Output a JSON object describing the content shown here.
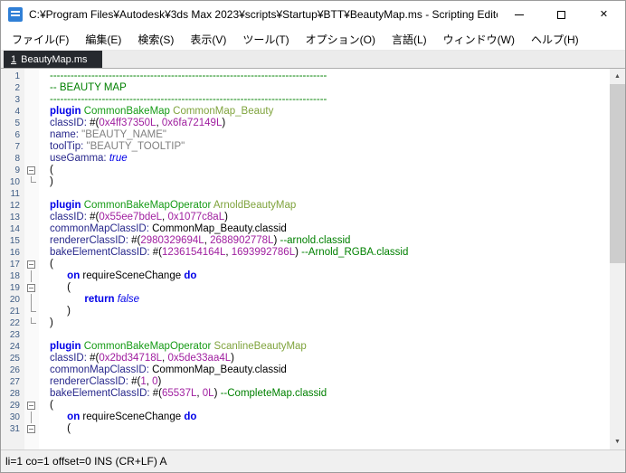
{
  "window": {
    "title": "C:¥Program Files¥Autodesk¥3ds Max 2023¥scripts¥Startup¥BTT¥BeautyMap.ms - Scripting Editor"
  },
  "icons": {
    "close": "✕",
    "scroll_up": "▲",
    "scroll_down": "▼"
  },
  "menu": {
    "items": [
      "ファイル(F)",
      "編集(E)",
      "検索(S)",
      "表示(V)",
      "ツール(T)",
      "オプション(O)",
      "言語(L)",
      "ウィンドウ(W)",
      "ヘルプ(H)"
    ]
  },
  "tab": {
    "number": "1",
    "label": "BeautyMap.ms"
  },
  "colors": {
    "comment": "#008000",
    "keyword": "#0000e8",
    "typename": "#169b16",
    "instance": "#7fa33c",
    "property": "#28288c",
    "number": "#a020a0",
    "string": "#808080",
    "plain": "#000000",
    "line_number": "#3e5c84",
    "active_tab": "#26292e"
  },
  "editor": {
    "lines": [
      {
        "n": 1,
        "fold": "",
        "segs": [
          [
            "cm",
            "--------------------------------------------------------------------------------"
          ]
        ]
      },
      {
        "n": 2,
        "fold": "",
        "segs": [
          [
            "cm",
            "-- BEAUTY MAP"
          ]
        ]
      },
      {
        "n": 3,
        "fold": "",
        "segs": [
          [
            "cm",
            "--------------------------------------------------------------------------------"
          ]
        ]
      },
      {
        "n": 4,
        "fold": "",
        "segs": [
          [
            "kw",
            "plugin"
          ],
          [
            "pl",
            " "
          ],
          [
            "ty",
            "CommonBakeMap"
          ],
          [
            "pl",
            " "
          ],
          [
            "nm",
            "CommonMap_Beauty"
          ]
        ]
      },
      {
        "n": 5,
        "fold": "",
        "segs": [
          [
            "pr",
            "classID:"
          ],
          [
            "pl",
            " #("
          ],
          [
            "num",
            "0x4ff37350L"
          ],
          [
            "pl",
            ", "
          ],
          [
            "num",
            "0x6fa72149L"
          ],
          [
            "pl",
            ")"
          ]
        ]
      },
      {
        "n": 6,
        "fold": "",
        "segs": [
          [
            "pr",
            "name:"
          ],
          [
            "pl",
            " "
          ],
          [
            "str",
            "\"BEAUTY_NAME\""
          ]
        ]
      },
      {
        "n": 7,
        "fold": "",
        "segs": [
          [
            "pr",
            "toolTip:"
          ],
          [
            "pl",
            " "
          ],
          [
            "str",
            "\"BEAUTY_TOOLTIP\""
          ]
        ]
      },
      {
        "n": 8,
        "fold": "",
        "segs": [
          [
            "pr",
            "useGamma:"
          ],
          [
            "pl",
            " "
          ],
          [
            "it",
            "true"
          ]
        ]
      },
      {
        "n": 9,
        "fold": "box",
        "segs": [
          [
            "pl",
            "("
          ]
        ]
      },
      {
        "n": 10,
        "fold": "end",
        "segs": [
          [
            "pl",
            ")"
          ]
        ]
      },
      {
        "n": 11,
        "fold": "",
        "segs": []
      },
      {
        "n": 12,
        "fold": "",
        "segs": [
          [
            "kw",
            "plugin"
          ],
          [
            "pl",
            " "
          ],
          [
            "ty",
            "CommonBakeMapOperator"
          ],
          [
            "pl",
            " "
          ],
          [
            "nm",
            "ArnoldBeautyMap"
          ]
        ]
      },
      {
        "n": 13,
        "fold": "",
        "segs": [
          [
            "pr",
            "classID:"
          ],
          [
            "pl",
            " #("
          ],
          [
            "num",
            "0x55ee7bdeL"
          ],
          [
            "pl",
            ", "
          ],
          [
            "num",
            "0x1077c8aL"
          ],
          [
            "pl",
            ")"
          ]
        ]
      },
      {
        "n": 14,
        "fold": "",
        "segs": [
          [
            "pr",
            "commonMapClassID:"
          ],
          [
            "pl",
            " CommonMap_Beauty.classid"
          ]
        ]
      },
      {
        "n": 15,
        "fold": "",
        "segs": [
          [
            "pr",
            "rendererClassID:"
          ],
          [
            "pl",
            " #("
          ],
          [
            "num",
            "2980329694L"
          ],
          [
            "pl",
            ", "
          ],
          [
            "num",
            "2688902778L"
          ],
          [
            "pl",
            ") "
          ],
          [
            "cm",
            "--arnold.classid"
          ]
        ]
      },
      {
        "n": 16,
        "fold": "",
        "segs": [
          [
            "pr",
            "bakeElementClassID:"
          ],
          [
            "pl",
            " #("
          ],
          [
            "num",
            "1236154164L"
          ],
          [
            "pl",
            ", "
          ],
          [
            "num",
            "1693992786L"
          ],
          [
            "pl",
            ") "
          ],
          [
            "cm",
            "--Arnold_RGBA.classid"
          ]
        ]
      },
      {
        "n": 17,
        "fold": "box",
        "segs": [
          [
            "pl",
            "("
          ]
        ]
      },
      {
        "n": 18,
        "fold": "vline",
        "segs": [
          [
            "pl",
            "      "
          ],
          [
            "kw",
            "on"
          ],
          [
            "pl",
            " requireSceneChange "
          ],
          [
            "kw",
            "do"
          ]
        ]
      },
      {
        "n": 19,
        "fold": "box",
        "segs": [
          [
            "pl",
            "      ("
          ]
        ]
      },
      {
        "n": 20,
        "fold": "vline",
        "segs": [
          [
            "pl",
            "            "
          ],
          [
            "kw",
            "return"
          ],
          [
            "pl",
            " "
          ],
          [
            "it",
            "false"
          ]
        ]
      },
      {
        "n": 21,
        "fold": "end",
        "segs": [
          [
            "pl",
            "      )"
          ]
        ]
      },
      {
        "n": 22,
        "fold": "end",
        "segs": [
          [
            "pl",
            ")"
          ]
        ]
      },
      {
        "n": 23,
        "fold": "",
        "segs": []
      },
      {
        "n": 24,
        "fold": "",
        "segs": [
          [
            "kw",
            "plugin"
          ],
          [
            "pl",
            " "
          ],
          [
            "ty",
            "CommonBakeMapOperator"
          ],
          [
            "pl",
            " "
          ],
          [
            "nm",
            "ScanlineBeautyMap"
          ]
        ]
      },
      {
        "n": 25,
        "fold": "",
        "segs": [
          [
            "pr",
            "classID:"
          ],
          [
            "pl",
            " #("
          ],
          [
            "num",
            "0x2bd34718L"
          ],
          [
            "pl",
            ", "
          ],
          [
            "num",
            "0x5de33aa4L"
          ],
          [
            "pl",
            ")"
          ]
        ]
      },
      {
        "n": 26,
        "fold": "",
        "segs": [
          [
            "pr",
            "commonMapClassID:"
          ],
          [
            "pl",
            " CommonMap_Beauty.classid"
          ]
        ]
      },
      {
        "n": 27,
        "fold": "",
        "segs": [
          [
            "pr",
            "rendererClassID:"
          ],
          [
            "pl",
            " #("
          ],
          [
            "num",
            "1"
          ],
          [
            "pl",
            ", "
          ],
          [
            "num",
            "0"
          ],
          [
            "pl",
            ")"
          ]
        ]
      },
      {
        "n": 28,
        "fold": "",
        "segs": [
          [
            "pr",
            "bakeElementClassID:"
          ],
          [
            "pl",
            " #("
          ],
          [
            "num",
            "65537L"
          ],
          [
            "pl",
            ", "
          ],
          [
            "num",
            "0L"
          ],
          [
            "pl",
            ") "
          ],
          [
            "cm",
            "--CompleteMap.classid"
          ]
        ]
      },
      {
        "n": 29,
        "fold": "box",
        "segs": [
          [
            "pl",
            "("
          ]
        ]
      },
      {
        "n": 30,
        "fold": "vline",
        "segs": [
          [
            "pl",
            "      "
          ],
          [
            "kw",
            "on"
          ],
          [
            "pl",
            " requireSceneChange "
          ],
          [
            "kw",
            "do"
          ]
        ]
      },
      {
        "n": 31,
        "fold": "box",
        "segs": [
          [
            "pl",
            "      ("
          ]
        ]
      }
    ]
  },
  "statusbar": {
    "text": "li=1 co=1 offset=0 INS (CR+LF) A"
  }
}
